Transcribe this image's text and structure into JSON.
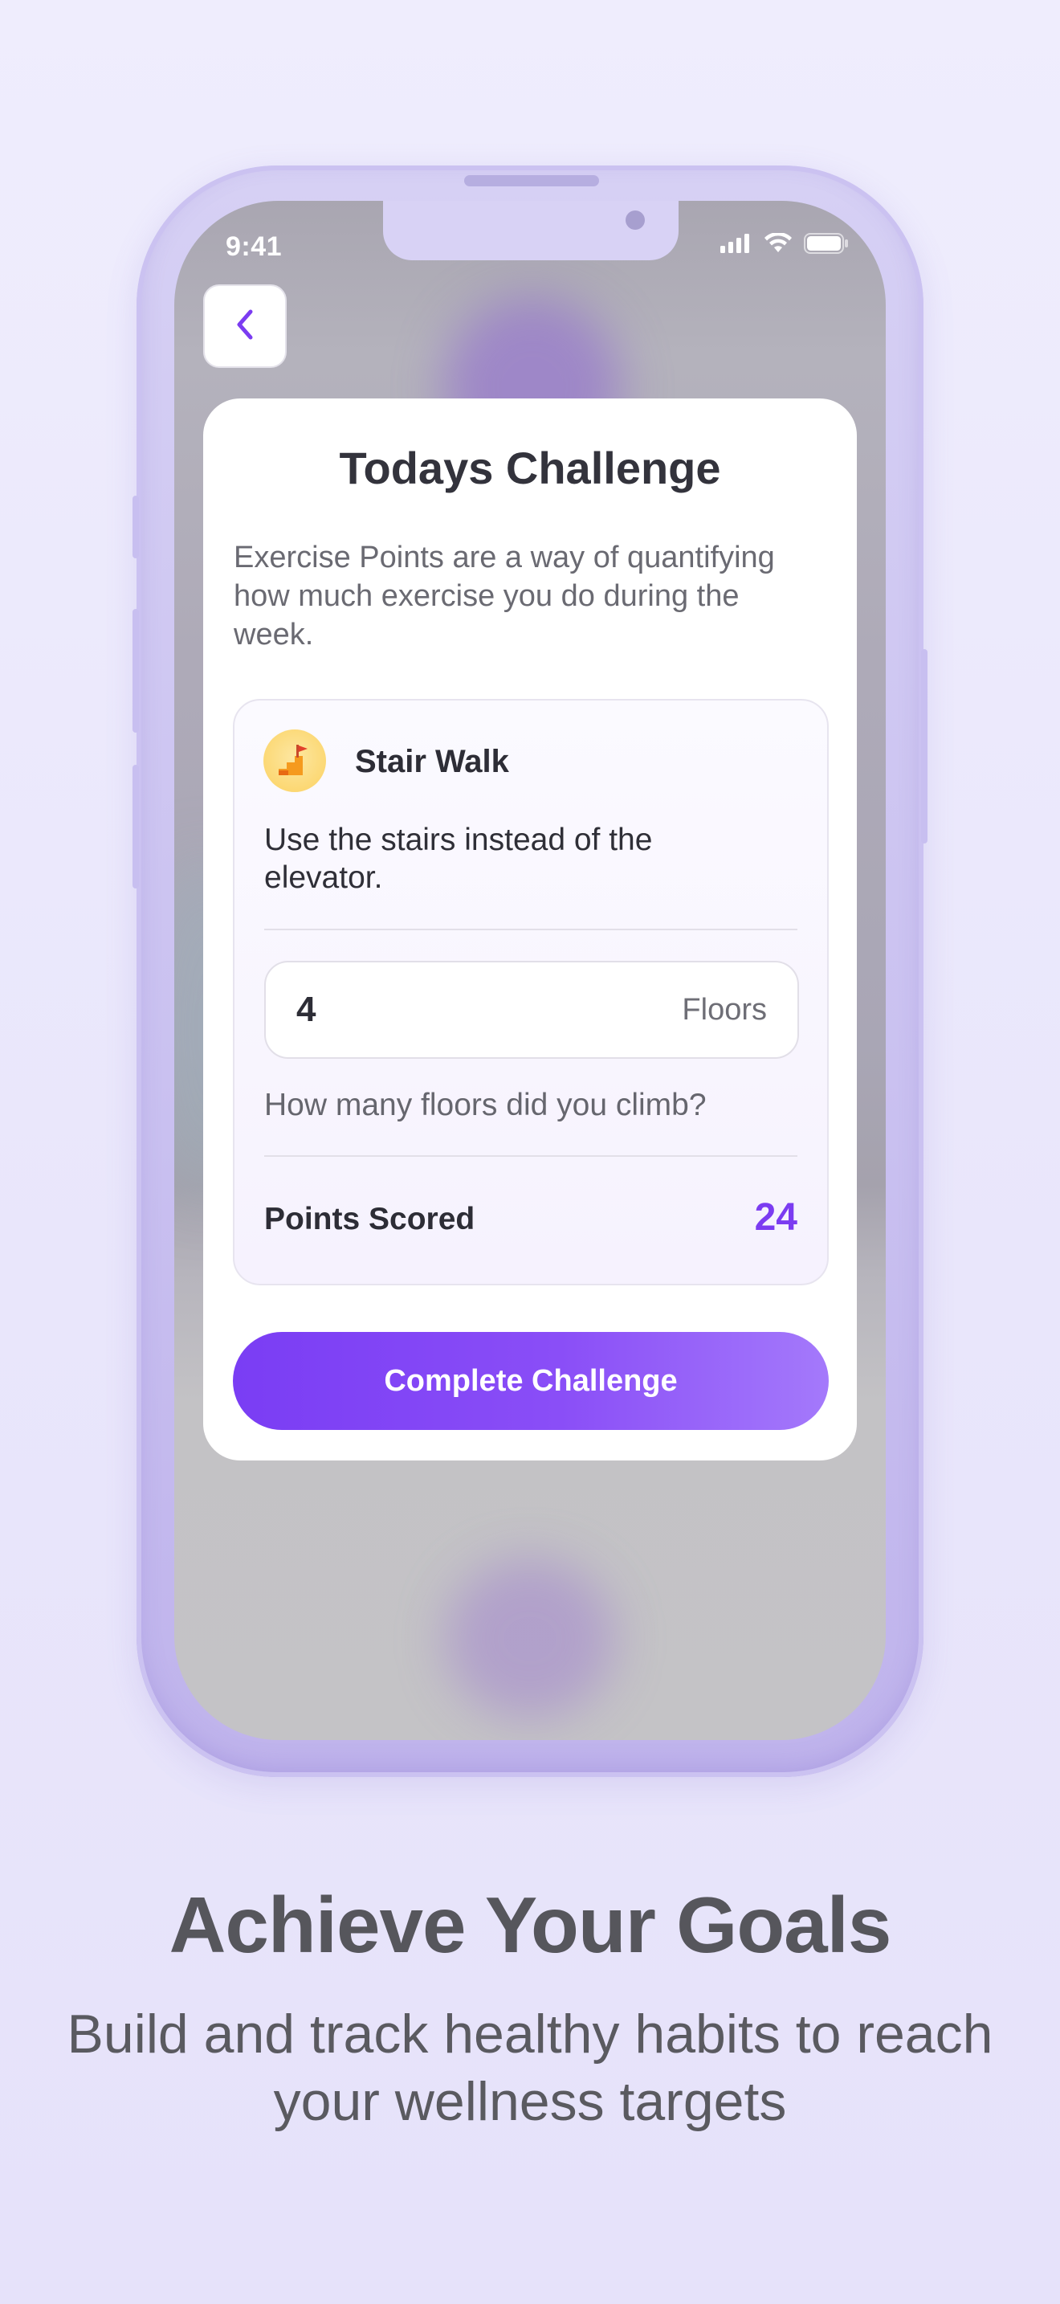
{
  "status_bar": {
    "time": "9:41",
    "icons": [
      "signal-icon",
      "wifi-icon",
      "battery-icon"
    ]
  },
  "nav": {
    "back_icon": "chevron-left-icon"
  },
  "card": {
    "title": "Todays Challenge",
    "description": "Exercise Points are a way of quantifying how much exercise you do during the week.",
    "challenge": {
      "icon": "stairs-icon",
      "name": "Stair Walk",
      "text": "Use the stairs instead of the elevator.",
      "input_value": "4",
      "input_unit": "Floors",
      "question": "How many floors did you climb?",
      "points_label": "Points Scored",
      "points_value": "24"
    },
    "button_label": "Complete Challenge"
  },
  "marketing": {
    "headline": "Achieve Your Goals",
    "subline": "Build and track healthy habits to reach your wellness targets"
  },
  "colors": {
    "accent": "#7b3cf1",
    "button_start": "#7a3df4",
    "button_end": "#a479fb",
    "background": "#ebe8fc",
    "frame": "#cfc7f2"
  }
}
